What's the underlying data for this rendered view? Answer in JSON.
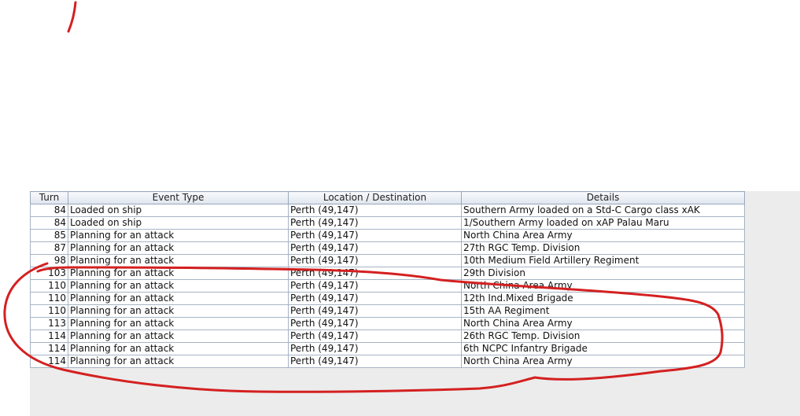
{
  "table": {
    "columns": [
      "Turn",
      "Event Type",
      "Location / Destination",
      "Details"
    ],
    "rows": [
      [
        "84",
        "Loaded on ship",
        "Perth (49,147)",
        "Southern Army loaded on a Std-C Cargo class xAK"
      ],
      [
        "84",
        "Loaded on ship",
        "Perth (49,147)",
        "1/Southern Army loaded on xAP Palau Maru"
      ],
      [
        "85",
        "Planning for an attack",
        "Perth (49,147)",
        "North China Area Army"
      ],
      [
        "87",
        "Planning for an attack",
        "Perth (49,147)",
        "27th RGC Temp. Division"
      ],
      [
        "98",
        "Planning for an attack",
        "Perth (49,147)",
        "10th Medium Field Artillery Regiment"
      ],
      [
        "103",
        "Planning for an attack",
        "Perth (49,147)",
        "29th Division"
      ],
      [
        "110",
        "Planning for an attack",
        "Perth (49,147)",
        "North China Area Army"
      ],
      [
        "110",
        "Planning for an attack",
        "Perth (49,147)",
        "12th Ind.Mixed Brigade"
      ],
      [
        "110",
        "Planning for an attack",
        "Perth (49,147)",
        "15th AA Regiment"
      ],
      [
        "113",
        "Planning for an attack",
        "Perth (49,147)",
        "North China Area Army"
      ],
      [
        "114",
        "Planning for an attack",
        "Perth (49,147)",
        "26th RGC Temp. Division"
      ],
      [
        "114",
        "Planning for an attack",
        "Perth (49,147)",
        "6th NCPC Infantry Brigade"
      ],
      [
        "114",
        "Planning for an attack",
        "Perth (49,147)",
        "North China Area Army"
      ]
    ]
  },
  "colors": {
    "annotation": "#d42020",
    "header_border": "#98a8ba",
    "panel_bg": "#ececec"
  }
}
